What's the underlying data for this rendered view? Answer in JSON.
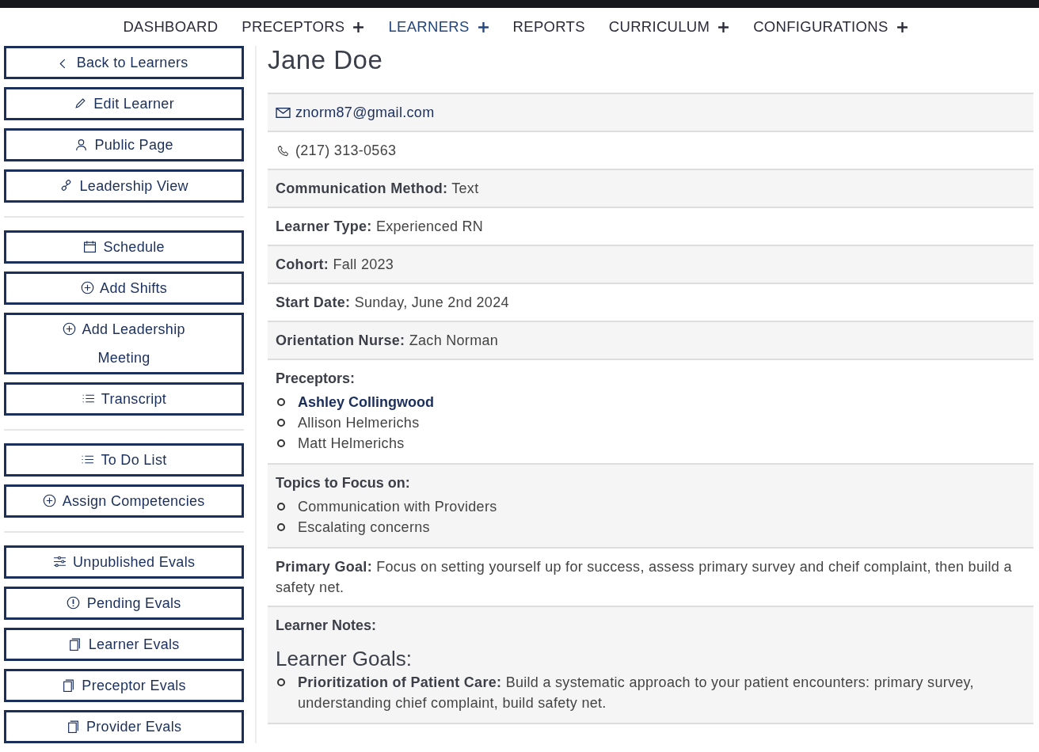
{
  "nav": [
    {
      "label": "DASHBOARD",
      "expandable": false,
      "selected": false
    },
    {
      "label": "PRECEPTORS",
      "expandable": true,
      "selected": false
    },
    {
      "label": "LEARNERS",
      "expandable": true,
      "selected": true
    },
    {
      "label": "REPORTS",
      "expandable": false,
      "selected": false
    },
    {
      "label": "CURRICULUM",
      "expandable": true,
      "selected": false
    },
    {
      "label": "CONFIGURATIONS",
      "expandable": true,
      "selected": false
    }
  ],
  "sidebar": {
    "groups": [
      [
        "Back to Learners",
        "Edit Learner",
        "Public Page",
        "Leadership View"
      ],
      [
        "Schedule",
        "Add Shifts",
        "Add Leadership Meeting",
        "Transcript"
      ],
      [
        "To Do List",
        "Assign Competencies"
      ],
      [
        "Unpublished Evals",
        "Pending Evals",
        "Learner Evals",
        "Preceptor Evals",
        "Provider Evals"
      ]
    ]
  },
  "learner": {
    "name": "Jane Doe",
    "rows": [
      {
        "kind": "email",
        "value": "znorm87@gmail.com"
      },
      {
        "kind": "phone",
        "value": "(217) 313-0563"
      },
      {
        "kind": "field",
        "label": "Communication Method:",
        "value": "Text"
      },
      {
        "kind": "field",
        "label": "Learner Type:",
        "value": "Experienced RN"
      },
      {
        "kind": "field",
        "label": "Cohort:",
        "value": "Fall 2023"
      },
      {
        "kind": "field",
        "label": "Start Date:",
        "value": "Sunday, June 2nd 2024"
      },
      {
        "kind": "field",
        "label": "Orientation Nurse:",
        "value": "Zach Norman"
      },
      {
        "kind": "list",
        "label": "Preceptors:",
        "items": [
          {
            "text": "Ashley Collingwood",
            "primary": true
          },
          {
            "text": "Allison Helmerichs",
            "primary": false
          },
          {
            "text": "Matt Helmerichs",
            "primary": false
          }
        ]
      },
      {
        "kind": "list",
        "label": "Topics to Focus on:",
        "items": [
          {
            "text": "Communication with Providers",
            "primary": false
          },
          {
            "text": "Escalating concerns",
            "primary": false
          }
        ]
      },
      {
        "kind": "field",
        "label": "Primary Goal:",
        "value": "Focus on setting yourself up for success, assess primary survey and cheif complaint, then build a safety net."
      },
      {
        "kind": "notes",
        "label": "Learner Notes:",
        "heading": "Learner Goals:",
        "goals": [
          {
            "label": "Prioritization of Patient Care:",
            "text": "Build a systematic approach to your patient encounters: primary survey, understanding chief complaint, build safety net."
          }
        ]
      }
    ]
  }
}
